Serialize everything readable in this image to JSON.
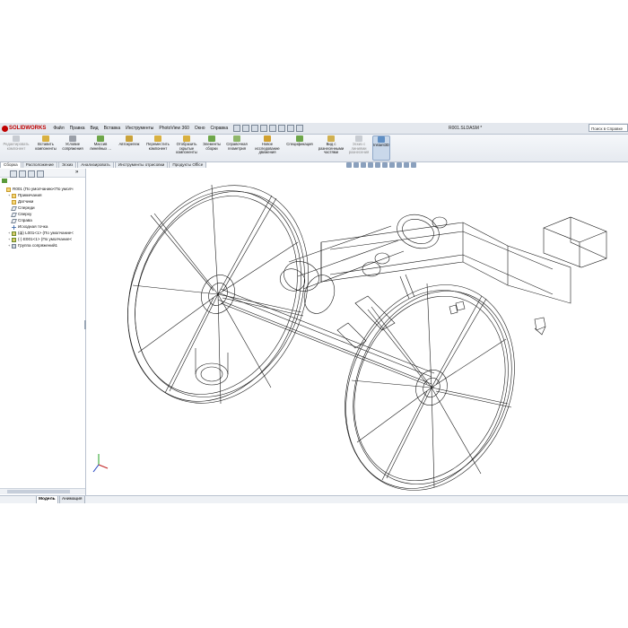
{
  "app": {
    "logo_text": "SOLIDWORKS",
    "document_title": "R001.SLDASM *",
    "help_search_placeholder": "Поиск в Справке"
  },
  "menu": [
    "Файл",
    "Правка",
    "Вид",
    "Вставка",
    "Инструменты",
    "PhotoView 360",
    "Окно",
    "Справка"
  ],
  "command_manager": [
    {
      "label": "Редактировать компонент",
      "state": "disabled"
    },
    {
      "label": "Вставить компоненты",
      "state": "normal"
    },
    {
      "label": "Условие сопряжения",
      "state": "normal"
    },
    {
      "label": "Массив линейных ...",
      "state": "normal"
    },
    {
      "label": "Автокрепеж",
      "state": "normal"
    },
    {
      "label": "Переместить компонент",
      "state": "normal"
    },
    {
      "label": "Отобразить скрытые компоненты",
      "state": "normal"
    },
    {
      "label": "Элементы сборки",
      "state": "normal"
    },
    {
      "label": "Справочная геометрия",
      "state": "normal"
    },
    {
      "label": "Новое исследование движения",
      "state": "normal"
    },
    {
      "label": "Спецификация",
      "state": "normal"
    },
    {
      "label": "Вид с разнесенными частями",
      "state": "normal"
    },
    {
      "label": "Эскиз с линиями разнесения",
      "state": "disabled"
    },
    {
      "label": "Instant3D",
      "state": "active"
    }
  ],
  "tabs": [
    "Сборка",
    "Расположение",
    "Эскиз",
    "Анализировать",
    "Инструменты отрисовки",
    "Продукты Office"
  ],
  "active_tab": "Сборка",
  "feature_tree": [
    {
      "label": "R001  (По умолчанию<По умолч",
      "icon": "assembly-icon",
      "indent": 0,
      "expander": ""
    },
    {
      "label": "Примечания",
      "icon": "annotations-icon",
      "indent": 1,
      "expander": "+"
    },
    {
      "label": "Датчики",
      "icon": "sensors-icon",
      "indent": 1,
      "expander": ""
    },
    {
      "label": "Спереди",
      "icon": "plane-icon",
      "indent": 1,
      "expander": ""
    },
    {
      "label": "Сверху",
      "icon": "plane-icon",
      "indent": 1,
      "expander": ""
    },
    {
      "label": "Справа",
      "icon": "plane-icon",
      "indent": 1,
      "expander": ""
    },
    {
      "label": "Исходная точка",
      "icon": "origin-icon",
      "indent": 1,
      "expander": ""
    },
    {
      "label": "(ф) L001<1> (По умолчание<",
      "icon": "part-icon",
      "indent": 1,
      "expander": "+"
    },
    {
      "label": "(-) E001<1> (По умолчание<",
      "icon": "part-icon",
      "indent": 1,
      "expander": "+"
    },
    {
      "label": "Группа сопряжений1",
      "icon": "mates-icon",
      "indent": 1,
      "expander": "+"
    }
  ],
  "bottom_tabs": [
    "Модель",
    "Анимация"
  ],
  "active_bottom_tab": "Модель",
  "colors": {
    "accent": "#c00000",
    "chrome": "#e4e8ee",
    "wire": "#1a1a1a"
  }
}
